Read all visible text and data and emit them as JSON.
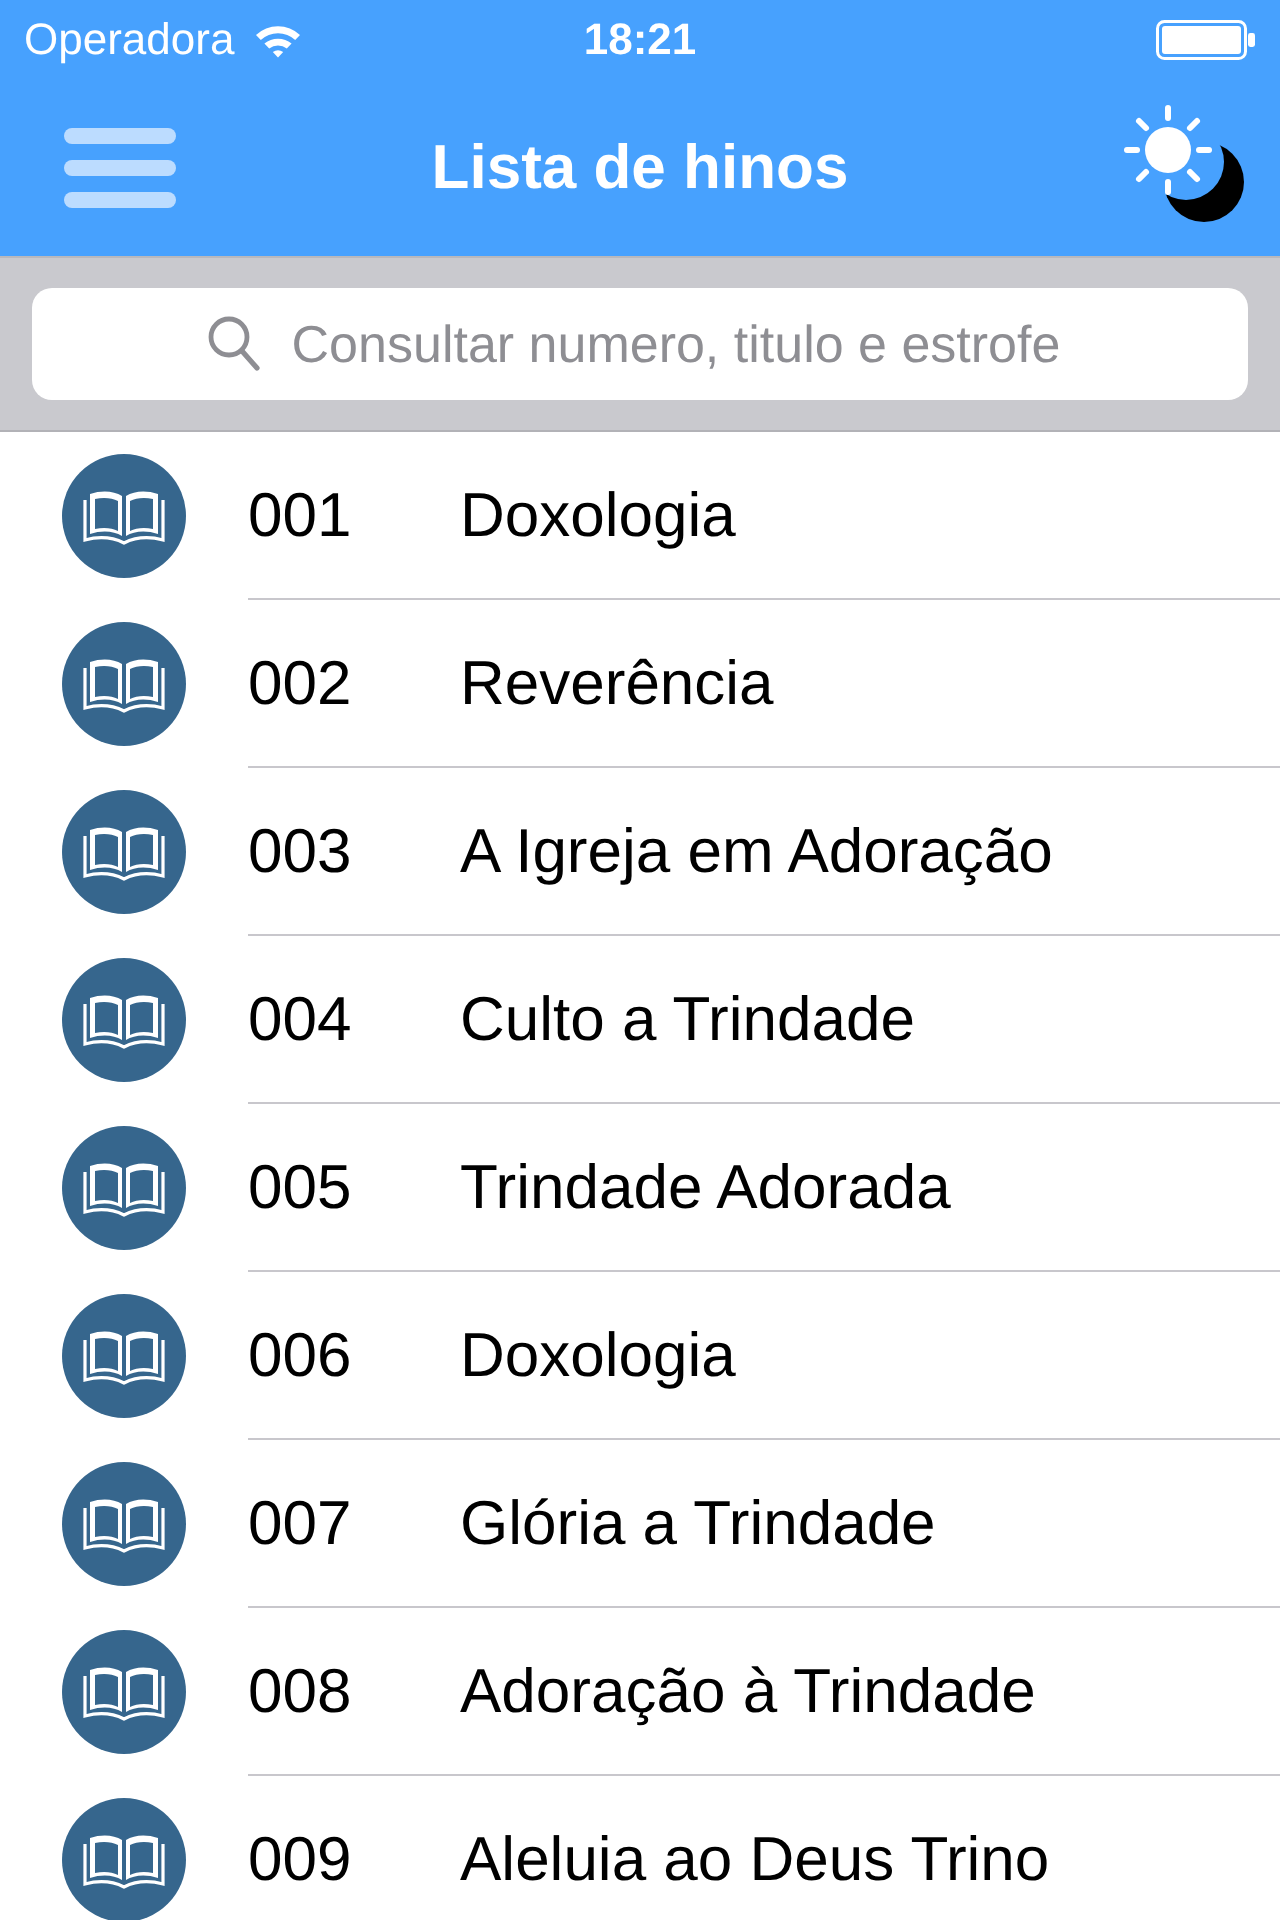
{
  "status_bar": {
    "carrier": "Operadora",
    "time": "18:21"
  },
  "nav_bar": {
    "title": "Lista de hinos"
  },
  "search": {
    "placeholder": "Consultar numero, titulo e estrofe"
  },
  "hymns": [
    {
      "number": "001",
      "title": "Doxologia"
    },
    {
      "number": "002",
      "title": "Reverência"
    },
    {
      "number": "003",
      "title": "A Igreja em Adoração"
    },
    {
      "number": "004",
      "title": "Culto a Trindade"
    },
    {
      "number": "005",
      "title": "Trindade Adorada"
    },
    {
      "number": "006",
      "title": "Doxologia"
    },
    {
      "number": "007",
      "title": "Glória a Trindade"
    },
    {
      "number": "008",
      "title": "Adoração à Trindade"
    },
    {
      "number": "009",
      "title": "Aleluia ao Deus Trino"
    }
  ]
}
